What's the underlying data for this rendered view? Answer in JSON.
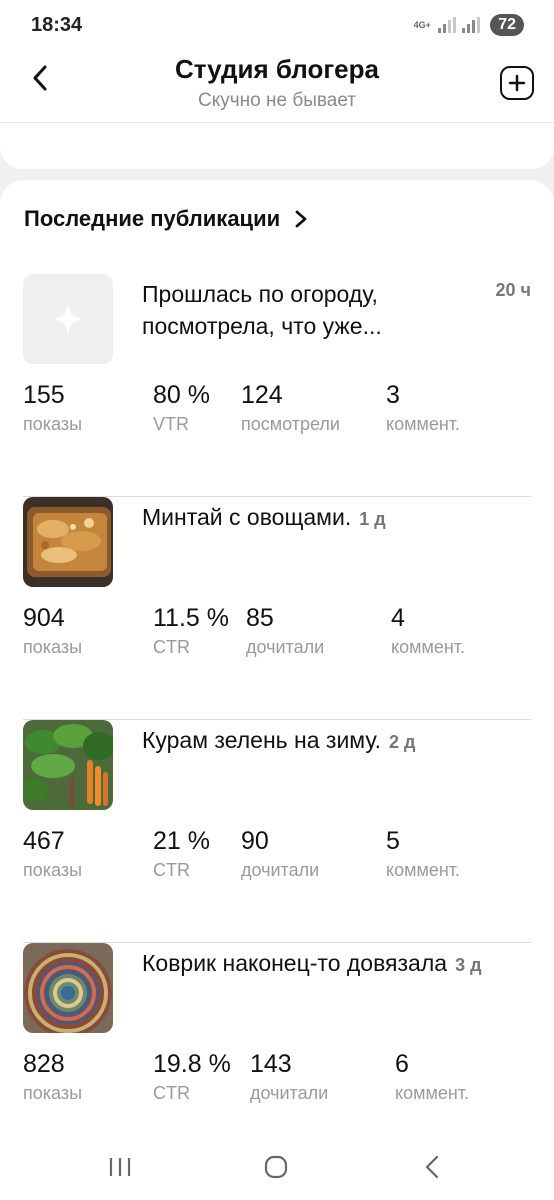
{
  "status_bar": {
    "time": "18:34",
    "network": "4G+",
    "battery": "72"
  },
  "header": {
    "title": "Студия блогера",
    "subtitle": "Скучно не бывает"
  },
  "section": {
    "title": "Последние публикации"
  },
  "posts": [
    {
      "title": "Прошлась по огороду, посмотрела, что уже...",
      "title_line1": "Прошлась по огороду,",
      "title_line2": "посмотрела, что уже...",
      "age": "20 ч",
      "thumb": "placeholder-star-icon",
      "stats": [
        {
          "value": "155",
          "label": "показы"
        },
        {
          "value": "80 %",
          "label": "VTR"
        },
        {
          "value": "124",
          "label": "посмотрели"
        },
        {
          "value": "3",
          "label": "коммент."
        }
      ]
    },
    {
      "title": "Минтай с овощами.",
      "age": "1 д",
      "thumb": "casserole-photo",
      "stats": [
        {
          "value": "904",
          "label": "показы"
        },
        {
          "value": "11.5 %",
          "label": "CTR"
        },
        {
          "value": "85",
          "label": "дочитали"
        },
        {
          "value": "4",
          "label": "коммент."
        }
      ]
    },
    {
      "title": "Курам зелень на зиму.",
      "age": "2 д",
      "thumb": "greens-carrots-photo",
      "stats": [
        {
          "value": "467",
          "label": "показы"
        },
        {
          "value": "21 %",
          "label": "CTR"
        },
        {
          "value": "90",
          "label": "дочитали"
        },
        {
          "value": "5",
          "label": "коммент."
        }
      ]
    },
    {
      "title": "Коврик наконец-то довязала",
      "age": "3 д",
      "thumb": "crochet-rug-photo",
      "stats": [
        {
          "value": "828",
          "label": "показы"
        },
        {
          "value": "19.8 %",
          "label": "CTR"
        },
        {
          "value": "143",
          "label": "дочитали"
        },
        {
          "value": "6",
          "label": "коммент."
        }
      ]
    }
  ],
  "colors": {
    "accent": "#111111",
    "muted": "#9a9a9a",
    "background": "#f0f0f0"
  }
}
